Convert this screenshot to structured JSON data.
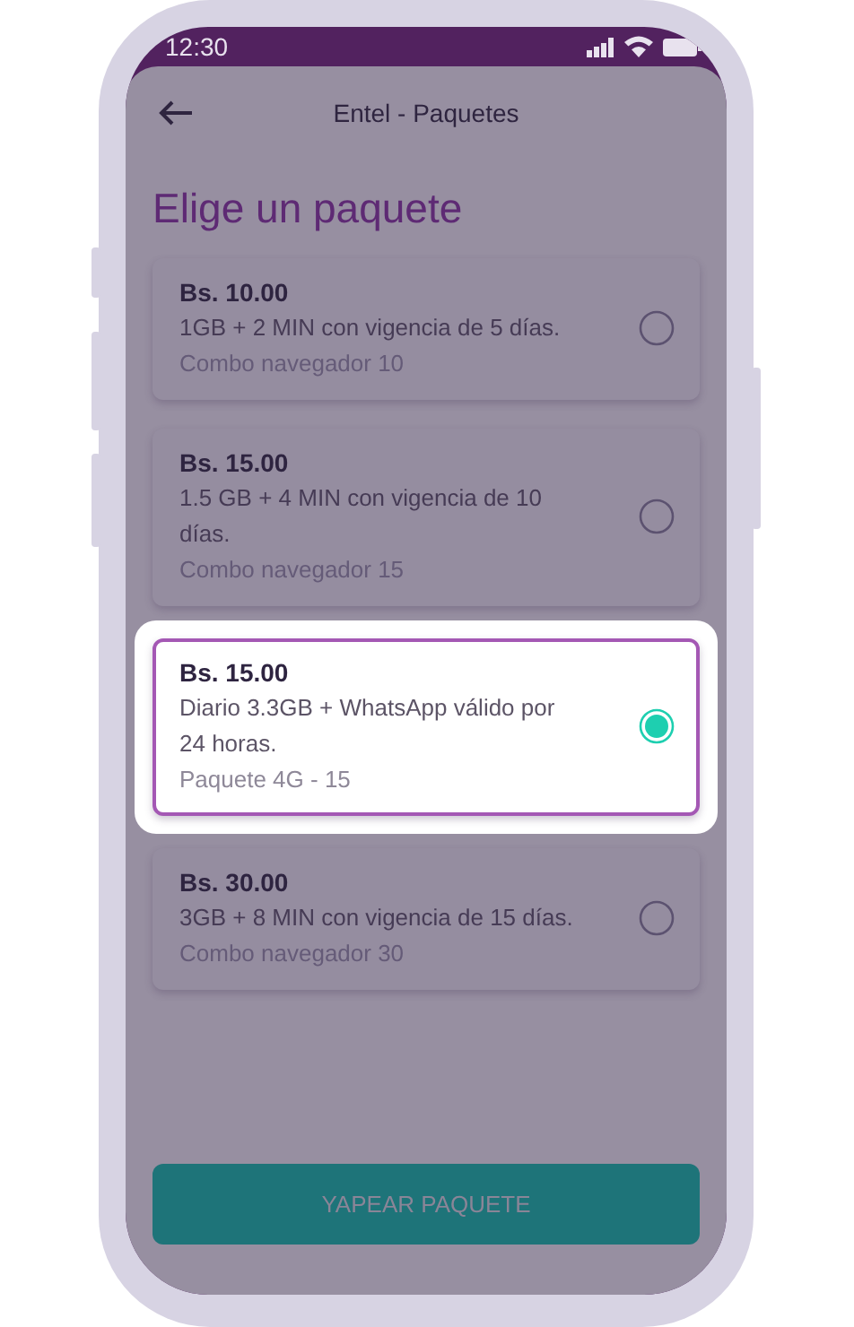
{
  "status_bar": {
    "time": "12:30"
  },
  "header": {
    "title": "Entel - Paquetes"
  },
  "heading": "Elige un paquete",
  "packages": [
    {
      "price": "Bs. 10.00",
      "description": "1GB + 2 MIN con vigencia de 5 días.",
      "name": "Combo navegador 10",
      "selected": false
    },
    {
      "price": "Bs. 15.00",
      "description": "1.5 GB + 4 MIN con vigencia de 10 días.",
      "name": "Combo navegador 15",
      "selected": false
    },
    {
      "price": "Bs. 15.00",
      "description": "Diario 3.3GB + WhatsApp válido por 24 horas.",
      "name": "Paquete 4G - 15",
      "selected": true
    },
    {
      "price": "Bs. 30.00",
      "description": "3GB + 8 MIN con vigencia de 15 días.",
      "name": "Combo navegador 30",
      "selected": false
    }
  ],
  "button": {
    "label": "YAPEAR PAQUETE"
  }
}
